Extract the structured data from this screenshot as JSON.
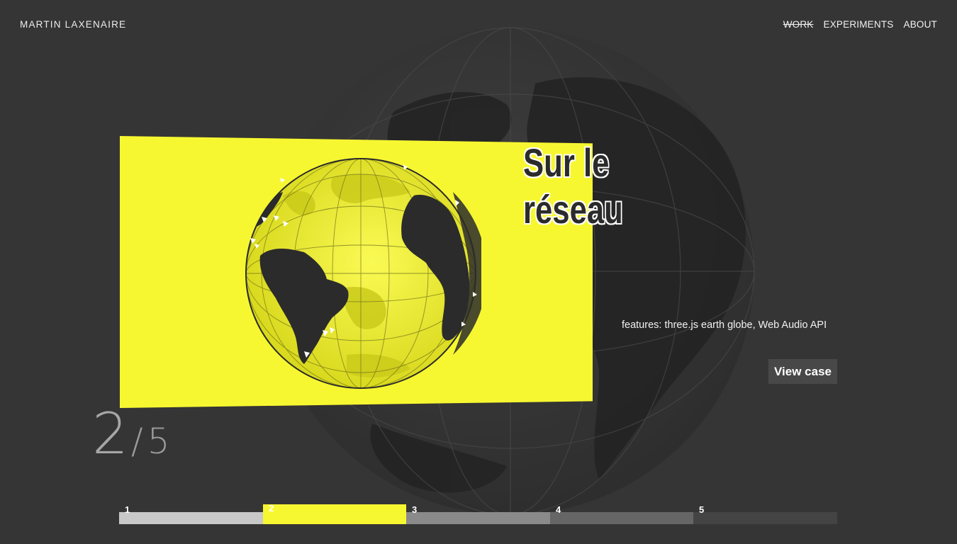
{
  "header": {
    "brand": "MARTIN LAXENAIRE",
    "nav": [
      {
        "label": "WORK",
        "active": true
      },
      {
        "label": "EXPERIMENTS",
        "active": false
      },
      {
        "label": "ABOUT",
        "active": false
      }
    ]
  },
  "project": {
    "title_line1": "Sur le",
    "title_line2": "réseau",
    "features": "features: three.js earth globe, Web Audio API",
    "view_case": "View case"
  },
  "counter": {
    "current": "2",
    "separator": "/",
    "total": "5"
  },
  "progress": {
    "segments": [
      {
        "label": "1",
        "color": "#c8c8c8",
        "active": false
      },
      {
        "label": "2",
        "color": "#f7f731",
        "active": true
      },
      {
        "label": "3",
        "color": "#8a8a8a",
        "active": false
      },
      {
        "label": "4",
        "color": "#666666",
        "active": false
      },
      {
        "label": "5",
        "color": "#444444",
        "active": false
      }
    ]
  },
  "colors": {
    "background": "#353535",
    "accent": "#f7f731",
    "land": "#2b2b2b"
  },
  "icons": [
    "earth-globe-icon"
  ]
}
